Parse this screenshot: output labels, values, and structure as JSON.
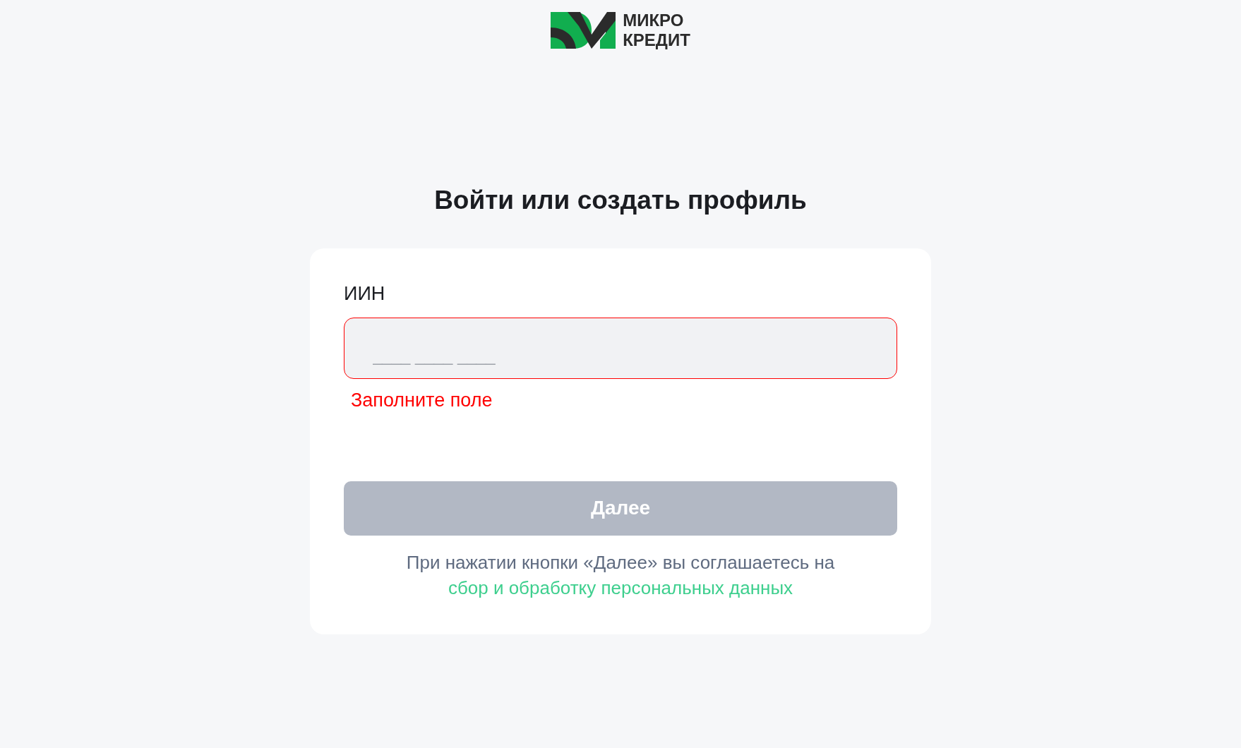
{
  "logo": {
    "line_1": "МИКРО",
    "line_2": "КРЕДИТ"
  },
  "title": "Войти или создать профиль",
  "form": {
    "label": "ИИН",
    "field": {
      "placeholder": "____ ____ ____",
      "error": true
    },
    "error_text": "Заполните поле",
    "button": {
      "label": "Далее",
      "disabled": true
    },
    "consent": {
      "text": "При нажатии кнопки «Далее» вы соглашаетесь на",
      "link": "сбор и обработку персональных данных"
    }
  }
}
